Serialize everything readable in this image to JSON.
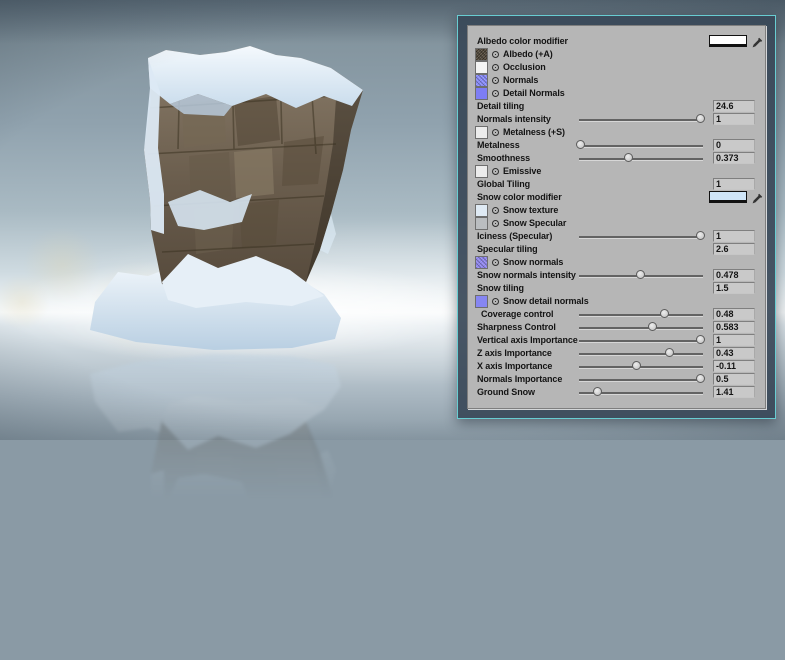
{
  "colors": {
    "teal": "#68cdd2",
    "frame": "#42556a",
    "panel": "#b6b6b6",
    "field": "#c9c9c9",
    "label": "#141414"
  },
  "panel": {
    "rows": [
      {
        "type": "color",
        "name": "albedo-color-modifier",
        "label": "Albedo color modifier",
        "swatch": "#ffffff"
      },
      {
        "type": "texture",
        "name": "albedo-map",
        "label": "Albedo (+A)",
        "thumb": "#453b2d",
        "noisy": true
      },
      {
        "type": "texture",
        "name": "occlusion-map",
        "label": "Occlusion",
        "thumb": "#f4f4f4"
      },
      {
        "type": "texture",
        "name": "normals-map",
        "label": "Normals",
        "thumb": "#8285fb",
        "noisy": true
      },
      {
        "type": "texture",
        "name": "detail-normals-map",
        "label": "Detail Normals",
        "thumb": "#7d7df4"
      },
      {
        "type": "field",
        "name": "detail-tiling",
        "label": "Detail tiling",
        "value": "24.6"
      },
      {
        "type": "slider",
        "name": "normals-intensity",
        "label": "Normals intensity",
        "value": "1",
        "pos": 0.985
      },
      {
        "type": "texture",
        "name": "metalness-map",
        "label": "Metalness (+S)",
        "thumb": "#ececec"
      },
      {
        "type": "slider",
        "name": "metalness",
        "label": "Metalness",
        "value": "0",
        "pos": 0.02
      },
      {
        "type": "slider",
        "name": "smoothness",
        "label": "Smoothness",
        "value": "0.373",
        "pos": 0.4
      },
      {
        "type": "texture",
        "name": "emissive-map",
        "label": "Emissive",
        "thumb": "#ececec"
      },
      {
        "type": "field",
        "name": "global-tiling",
        "label": "Global Tiling",
        "value": "1"
      },
      {
        "type": "color",
        "name": "snow-color-modifier",
        "label": "Snow color modifier",
        "swatch": "#cfe5f8"
      },
      {
        "type": "texture",
        "name": "snow-texture-map",
        "label": "Snow texture",
        "thumb": "#dfeaf4"
      },
      {
        "type": "texture",
        "name": "snow-specular-map",
        "label": "Snow Specular",
        "thumb": "#babdc0"
      },
      {
        "type": "slider",
        "name": "iciness-specular",
        "label": "Iciness (Specular)",
        "value": "1",
        "pos": 0.985
      },
      {
        "type": "field",
        "name": "specular-tiling",
        "label": "Specular tiling",
        "value": "2.6"
      },
      {
        "type": "texture",
        "name": "snow-normals-map",
        "label": "Snow normals",
        "thumb": "#8a80ef",
        "noisy": true
      },
      {
        "type": "slider",
        "name": "snow-normals-intensity",
        "label": "Snow normals intensity",
        "value": "0.478",
        "pos": 0.5
      },
      {
        "type": "field",
        "name": "snow-tiling",
        "label": "Snow tiling",
        "value": "1.5"
      },
      {
        "type": "texture",
        "name": "snow-detail-normals-map",
        "label": "Snow detail normals",
        "thumb": "#8686f2"
      },
      {
        "type": "slider",
        "name": "coverage-control",
        "label": "Coverage control",
        "value": "0.48",
        "pos": 0.69,
        "indent": true
      },
      {
        "type": "slider",
        "name": "sharpness-control",
        "label": "Sharpness Control",
        "value": "0.583",
        "pos": 0.6
      },
      {
        "type": "slider",
        "name": "vertical-axis-importance",
        "label": "Vertical axis Importance",
        "value": "1",
        "pos": 0.985
      },
      {
        "type": "slider",
        "name": "z-axis-importance",
        "label": "Z axis Importance",
        "value": "0.43",
        "pos": 0.73
      },
      {
        "type": "slider",
        "name": "x-axis-importance",
        "label": "X axis Importance",
        "value": "-0.11",
        "pos": 0.47
      },
      {
        "type": "slider",
        "name": "normals-importance",
        "label": "Normals Importance",
        "value": "0.5",
        "pos": 0.985
      },
      {
        "type": "slider",
        "name": "ground-snow",
        "label": "Ground Snow",
        "value": "1.41",
        "pos": 0.15
      }
    ]
  }
}
